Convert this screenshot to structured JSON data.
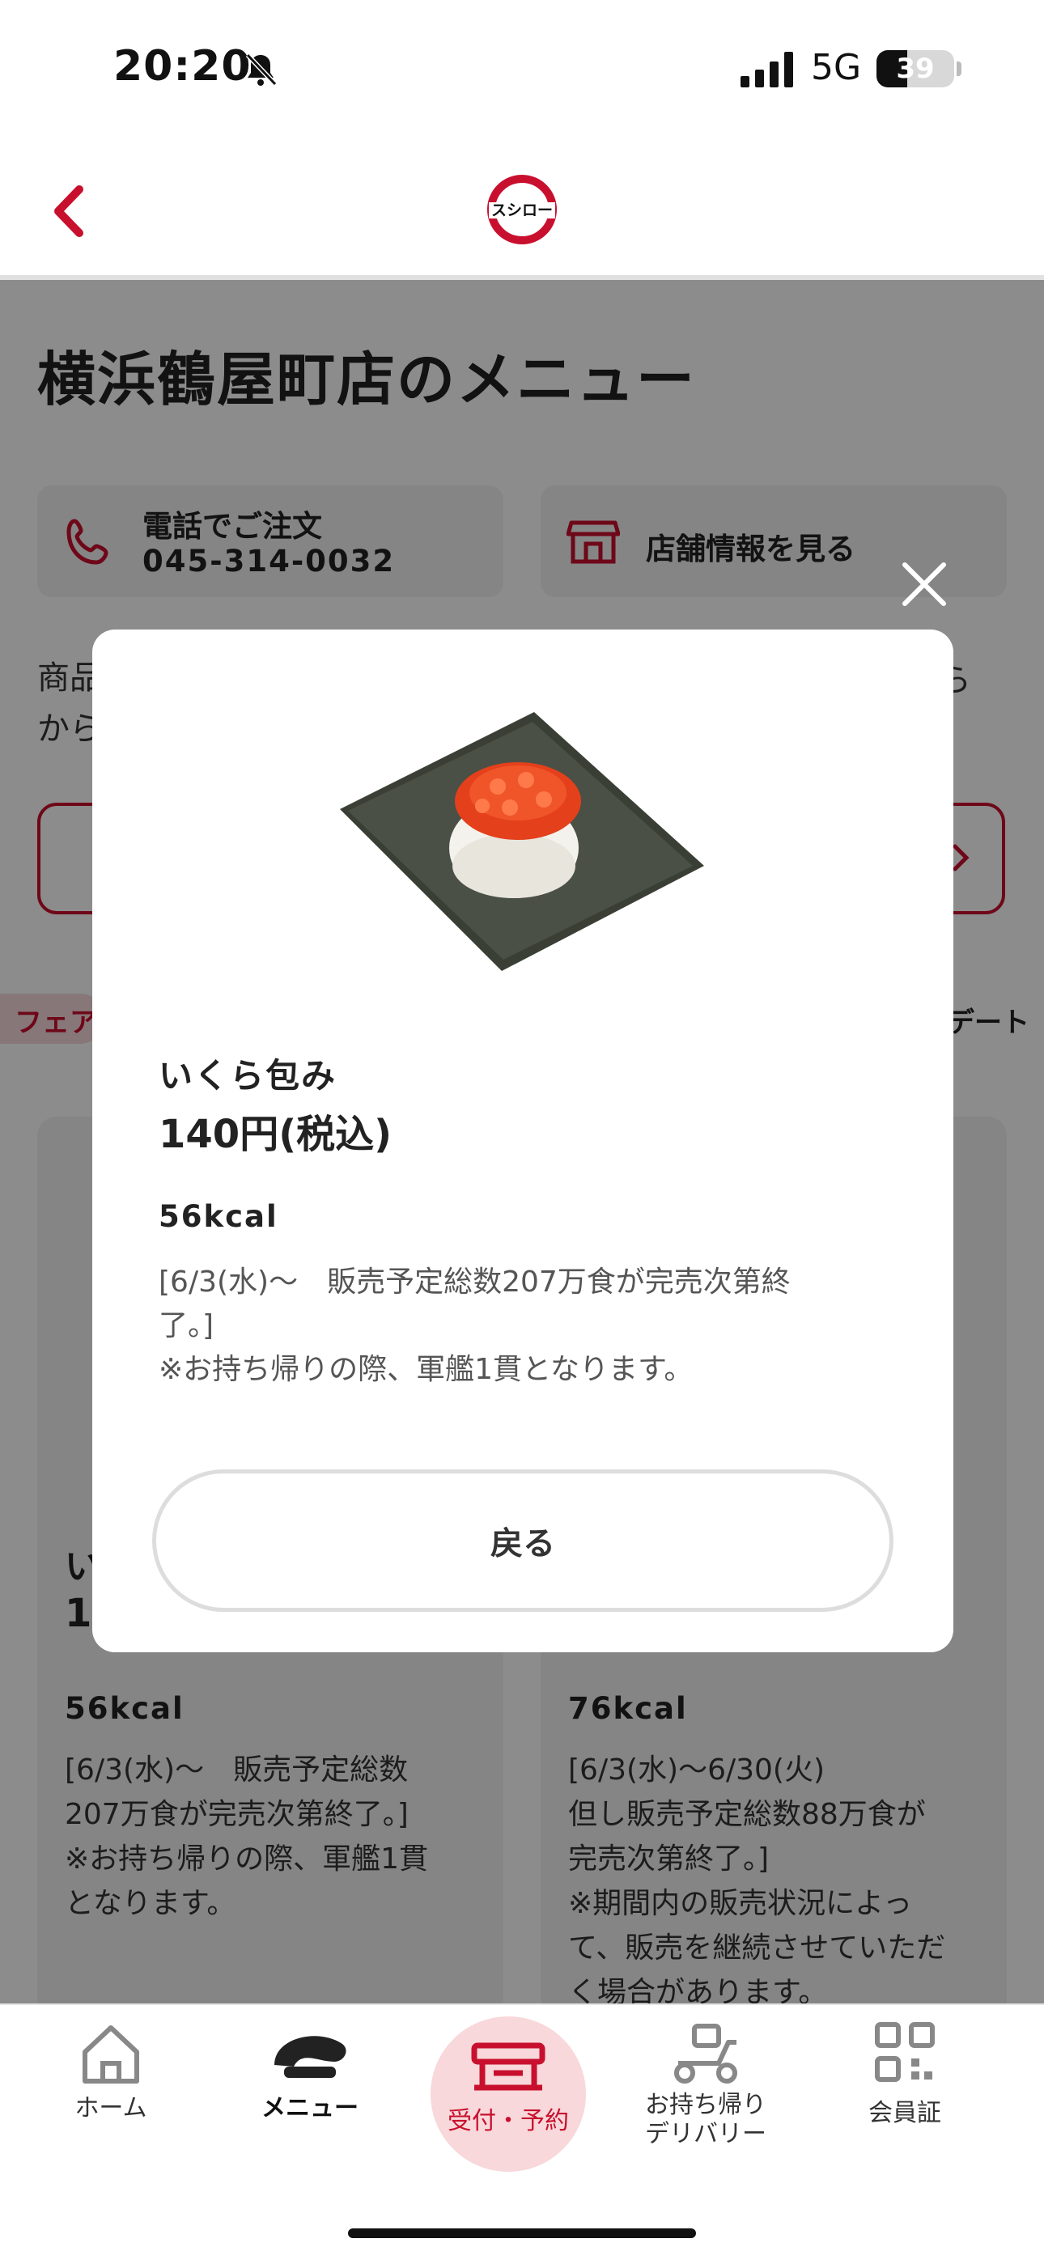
{
  "status_bar": {
    "time": "20:20",
    "network": "5G",
    "battery": "39"
  },
  "header": {
    "logo_text": "スシロー"
  },
  "page": {
    "title": "横浜鶴屋町店のメニュー",
    "phone_card": {
      "label": "電話でご注文",
      "number": "045-314-0032"
    },
    "store_card": {
      "label": "店舗情報を見る"
    },
    "desc_fragment_1": "商品",
    "desc_fragment_2": "から",
    "desc_fragment_3": "ら",
    "tab_fragment": "フェア",
    "update_fragment": "デート",
    "left_card": {
      "name_fragment": "い",
      "price_fragment": "1",
      "kcal": "56kcal",
      "note": "[6/3(水)〜　販売予定総数\n207万食が完売次第終了。]\n※お持ち帰りの際、軍艦1貫\nとなります。"
    },
    "right_card": {
      "kcal": "76kcal",
      "note": "[6/3(水)〜6/30(火)\n但し販売予定総数88万食が\n完売次第終了。]\n※期間内の販売状況によっ\nて、販売を継続させていただ\nく場合があります。"
    }
  },
  "modal": {
    "item_name": "いくら包み",
    "price": "140円(税込)",
    "kcal": "56kcal",
    "note": "[6/3(水)〜　販売予定総数207万食が完売次第終\n了。]\n※お持ち帰りの際、軍艦1貫となります。",
    "back_button": "戻る"
  },
  "bottom_nav": {
    "home": "ホーム",
    "menu": "メニュー",
    "reservation": "受付・予約",
    "takeout": "お持ち帰り\nデリバリー",
    "member": "会員証"
  },
  "colors": {
    "accent": "#c8102e",
    "overlay": "rgba(0,0,0,0.45)",
    "reservation_bg": "#f8d8da"
  }
}
